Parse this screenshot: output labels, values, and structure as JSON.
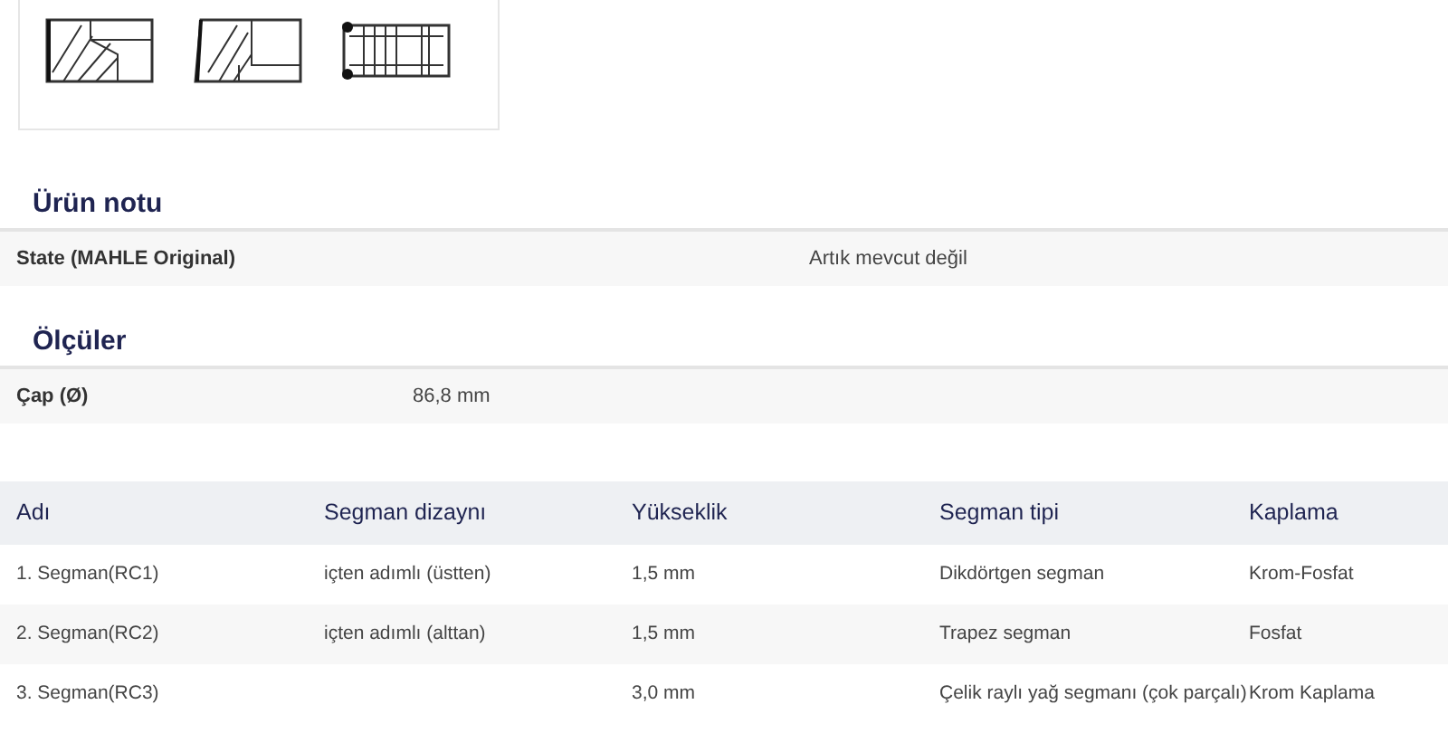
{
  "ring_images": [
    {
      "kind": "rectangular"
    },
    {
      "kind": "taper"
    },
    {
      "kind": "oil"
    }
  ],
  "product_note": {
    "title": "Ürün notu",
    "rows": [
      {
        "label": "State (MAHLE Original)",
        "value": "Artık mevcut değil"
      }
    ]
  },
  "dimensions": {
    "title": "Ölçüler",
    "rows": [
      {
        "label": "Çap (Ø)",
        "value": "86,8 mm"
      }
    ]
  },
  "rings_table": {
    "columns": [
      "Adı",
      "Segman dizaynı",
      "Yükseklik",
      "Segman tipi",
      "Kaplama"
    ],
    "rows": [
      [
        "1. Segman(RC1)",
        "içten adımlı (üstten)",
        "1,5 mm",
        "Dikdörtgen segman",
        "Krom-Fosfat"
      ],
      [
        "2. Segman(RC2)",
        "içten adımlı (alttan)",
        "1,5 mm",
        "Trapez segman",
        "Fosfat"
      ],
      [
        "3. Segman(RC3)",
        "",
        "3,0 mm",
        "Çelik raylı yağ segmanı (çok parçalı)",
        "Krom Kaplama"
      ]
    ]
  }
}
